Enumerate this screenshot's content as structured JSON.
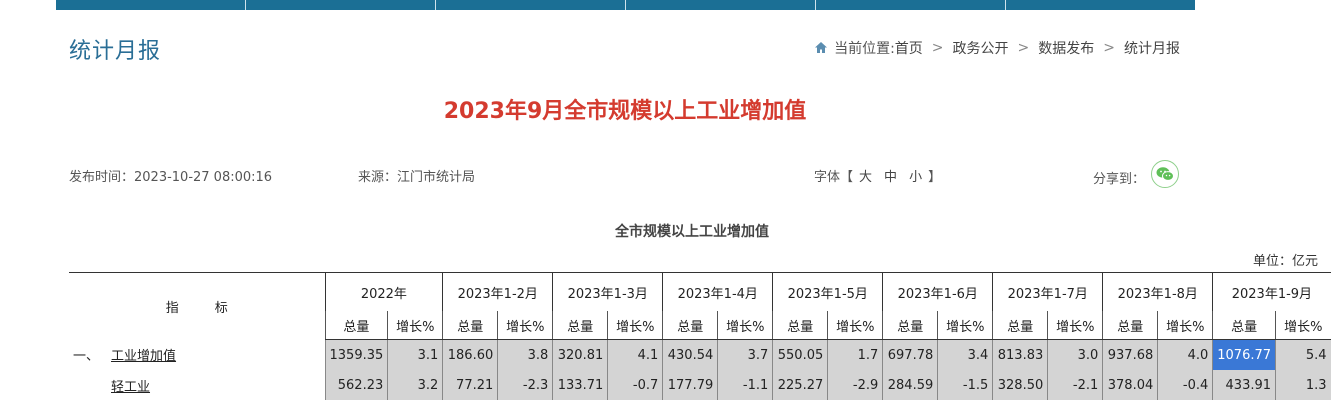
{
  "page": {
    "title": "统计月报",
    "breadcrumb": {
      "prefix": "当前位置:",
      "items": [
        "首页",
        "政务公开",
        "数据发布",
        "统计月报"
      ],
      "separator": ">"
    }
  },
  "article": {
    "title": "2023年9月全市规模以上工业增加值",
    "publish": "发布时间：2023-10-27 08:00:16",
    "source": "来源：江门市统计局",
    "font_label": "字体",
    "font_open": "【",
    "font_close": "】",
    "font_sizes": [
      "大",
      "中",
      "小"
    ],
    "share_label": "分享到："
  },
  "table": {
    "title": "全市规模以上工业增加值",
    "unit": "单位：亿元",
    "indicator_header": [
      "指",
      "标"
    ],
    "periods": [
      "2022年",
      "2023年1-2月",
      "2023年1-3月",
      "2023年1-4月",
      "2023年1-5月",
      "2023年1-6月",
      "2023年1-7月",
      "2023年1-8月",
      "2023年1-9月"
    ],
    "sub_headers": [
      "总量",
      "增长%"
    ],
    "rows": [
      {
        "prefix": "一、",
        "name": "工业增加值",
        "values": [
          "1359.35",
          "3.1",
          "186.60",
          "3.8",
          "320.81",
          "4.1",
          "430.54",
          "3.7",
          "550.05",
          "1.7",
          "697.78",
          "3.4",
          "813.83",
          "3.0",
          "937.68",
          "4.0",
          "1076.77",
          "5.4"
        ]
      },
      {
        "prefix": "",
        "name": "轻工业",
        "values": [
          "562.23",
          "3.2",
          "77.21",
          "-2.3",
          "133.71",
          "-0.7",
          "177.79",
          "-1.1",
          "225.27",
          "-2.9",
          "284.59",
          "-1.5",
          "328.50",
          "-2.1",
          "378.04",
          "-0.4",
          "433.91",
          "1.3"
        ]
      }
    ]
  },
  "colors": {
    "nav": "#1b6f95",
    "title_red": "#d43b2f",
    "page_title_blue": "#2a6e96",
    "selection": "#3a78d6",
    "cell_gray": "#d4d4d4"
  },
  "icons": {
    "home": "home-icon",
    "share": "wechat-icon"
  }
}
